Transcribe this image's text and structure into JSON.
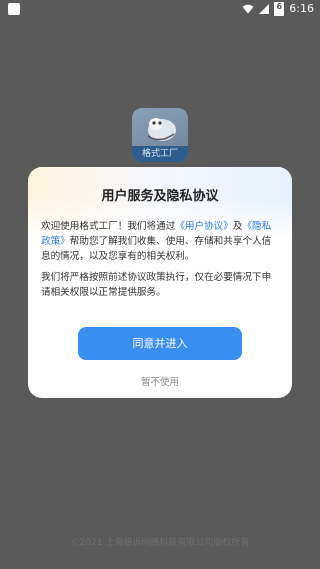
{
  "status_bar": {
    "time": "6:16",
    "battery_text": "6"
  },
  "app": {
    "icon_label": "格式工厂"
  },
  "dialog": {
    "title": "用户服务及隐私协议",
    "p1_part1": "欢迎使用格式工厂！我们将通过",
    "link_user_agreement": "《用户协议》",
    "p1_and": "及",
    "link_privacy_policy": "《隐私政策》",
    "p1_part2": "帮助您了解我们收集、使用、存储和共享个人信息的情况，以及您享有的相关权利。",
    "p2": "我们将严格按照前述协议政策执行，仅在必要情况下申请相关权限以正常提供服务。",
    "agree_label": "同意并进入",
    "decline_label": "暂不使用"
  },
  "footer": {
    "copyright": "©2021 上海格诉网络科技有限公司版权所有"
  },
  "colors": {
    "accent": "#3a8ef2",
    "link": "#2b7be5",
    "backdrop": "#5a5a5a"
  }
}
